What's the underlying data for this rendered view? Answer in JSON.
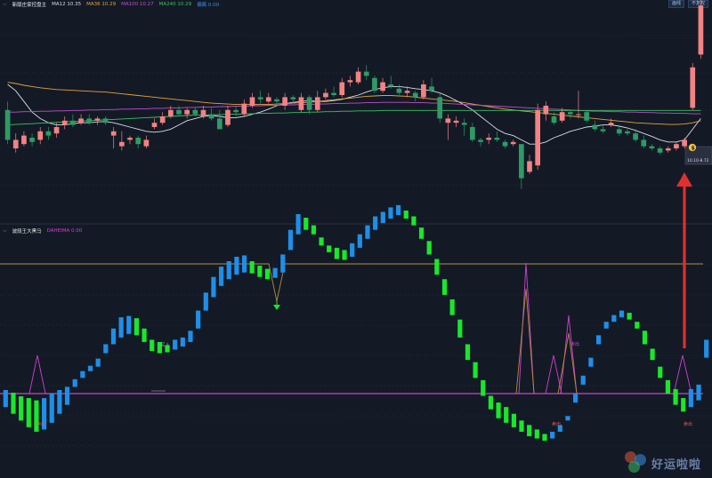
{
  "main_header": {
    "indicator_name": "新版庄家控盘主",
    "ma_items": [
      {
        "label": "MA12 10.35",
        "color": "#d8dde6"
      },
      {
        "label": "MA36 10.29",
        "color": "#e6a23c"
      },
      {
        "label": "MA100 10.27",
        "color": "#c050c8"
      },
      {
        "label": "MA240 10.29",
        "color": "#3cc060"
      },
      {
        "label": "偏离 0.00",
        "color": "#3a8ee6"
      }
    ]
  },
  "toolbar": {
    "btn1": "画线",
    "btn2": "不复权"
  },
  "price_tag": "10.10-8.72",
  "sub_header": {
    "indicator_name": "波段王大黑马",
    "item": {
      "label": "DAHEIMA 0.00",
      "color": "#d040d0"
    }
  },
  "annotations": {
    "buy": "买入",
    "sell1": "卖出",
    "sell2": "卖出",
    "sell3": "卖出",
    "sell4": "卖出"
  },
  "watermark": "好运啦啦",
  "colors": {
    "up": "#f38282",
    "down": "#2e9b65",
    "bar_blue": "#1e8fe8",
    "bar_green": "#18e82a",
    "orange_line": "#b78a3a",
    "magenta": "#d040d0",
    "arrow": "#e03030"
  },
  "chart_data": [
    {
      "type": "candlestick",
      "candles": [
        [
          10.3,
          9.6,
          10.5,
          9.5
        ],
        [
          9.4,
          9.6,
          9.75,
          9.3
        ],
        [
          9.5,
          9.7,
          9.8,
          9.45
        ],
        [
          9.65,
          9.55,
          9.75,
          9.45
        ],
        [
          9.6,
          9.8,
          9.9,
          9.5
        ],
        [
          9.8,
          9.7,
          9.9,
          9.6
        ],
        [
          9.75,
          9.9,
          10.0,
          9.65
        ],
        [
          9.95,
          10.05,
          10.15,
          9.85
        ],
        [
          10.05,
          9.95,
          10.2,
          9.9
        ],
        [
          10.0,
          10.1,
          10.2,
          9.95
        ],
        [
          10.1,
          10.0,
          10.2,
          9.95
        ],
        [
          10.05,
          10.1,
          10.15,
          9.95
        ],
        [
          10.1,
          10.0,
          10.15,
          9.95
        ],
        [
          9.7,
          9.8,
          9.9,
          9.4
        ],
        [
          9.45,
          9.55,
          9.8,
          9.35
        ],
        [
          9.6,
          9.65,
          9.7,
          9.5
        ],
        [
          9.65,
          9.5,
          9.7,
          9.4
        ],
        [
          9.45,
          9.6,
          9.7,
          9.4
        ],
        [
          9.9,
          10.0,
          10.1,
          9.85
        ],
        [
          10.0,
          10.15,
          10.25,
          9.95
        ],
        [
          10.15,
          10.3,
          10.4,
          10.1
        ],
        [
          10.3,
          10.2,
          10.4,
          10.15
        ],
        [
          10.2,
          10.3,
          10.35,
          10.1
        ],
        [
          10.3,
          10.2,
          10.35,
          10.15
        ],
        [
          10.15,
          10.3,
          10.4,
          10.1
        ],
        [
          10.2,
          10.1,
          10.35,
          10.05
        ],
        [
          10.1,
          9.85,
          10.3,
          9.85
        ],
        [
          9.95,
          10.3,
          10.4,
          9.9
        ],
        [
          10.3,
          10.25,
          10.4,
          10.15
        ],
        [
          10.2,
          10.45,
          10.55,
          10.15
        ],
        [
          10.4,
          10.6,
          10.7,
          10.35
        ],
        [
          10.6,
          10.55,
          10.75,
          10.45
        ],
        [
          10.5,
          10.6,
          10.7,
          10.45
        ],
        [
          10.55,
          10.5,
          10.6,
          10.4
        ],
        [
          10.4,
          10.6,
          10.7,
          10.3
        ],
        [
          10.6,
          10.55,
          10.65,
          10.45
        ],
        [
          10.3,
          10.6,
          10.7,
          10.25
        ],
        [
          10.6,
          10.3,
          10.65,
          10.2
        ],
        [
          10.3,
          10.6,
          10.75,
          10.25
        ],
        [
          10.6,
          10.7,
          10.8,
          10.55
        ],
        [
          10.7,
          10.65,
          10.85,
          10.6
        ],
        [
          10.65,
          10.95,
          11.05,
          10.6
        ],
        [
          10.95,
          11.0,
          11.1,
          10.85
        ],
        [
          10.95,
          11.2,
          11.3,
          10.9
        ],
        [
          11.2,
          11.1,
          11.35,
          11.0
        ],
        [
          11.05,
          10.75,
          11.1,
          10.7
        ],
        [
          10.75,
          10.95,
          11.05,
          10.7
        ],
        [
          10.9,
          10.85,
          11.1,
          10.8
        ],
        [
          10.8,
          10.7,
          10.9,
          10.65
        ],
        [
          10.7,
          10.75,
          10.85,
          10.6
        ],
        [
          10.7,
          10.6,
          10.75,
          10.5
        ],
        [
          10.6,
          10.9,
          11.0,
          10.55
        ],
        [
          10.85,
          10.75,
          11.05,
          10.7
        ],
        [
          10.6,
          10.1,
          10.7,
          10.0
        ],
        [
          10.0,
          10.1,
          10.2,
          9.6
        ],
        [
          10.0,
          10.05,
          10.15,
          9.9
        ],
        [
          10.0,
          9.95,
          10.1,
          9.7
        ],
        [
          9.9,
          9.6,
          10.0,
          9.55
        ],
        [
          9.6,
          9.55,
          9.65,
          9.45
        ],
        [
          9.6,
          9.65,
          9.75,
          9.5
        ],
        [
          9.65,
          9.6,
          9.8,
          9.55
        ],
        [
          9.55,
          9.45,
          9.6,
          9.4
        ],
        [
          9.5,
          9.55,
          9.6,
          9.45
        ],
        [
          9.5,
          8.7,
          9.5,
          8.45
        ],
        [
          8.85,
          9.1,
          9.25,
          8.8
        ],
        [
          9.0,
          10.3,
          10.45,
          8.9
        ],
        [
          10.2,
          10.4,
          10.5,
          10.05
        ],
        [
          10.15,
          10.0,
          10.25,
          9.95
        ],
        [
          10.05,
          10.25,
          10.35,
          10.0
        ],
        [
          10.25,
          10.2,
          10.3,
          10.1
        ],
        [
          10.2,
          10.2,
          10.75,
          10.1
        ],
        [
          10.25,
          10.05,
          10.3,
          10.0
        ],
        [
          9.95,
          9.85,
          10.05,
          9.8
        ],
        [
          9.85,
          9.8,
          9.95,
          9.75
        ],
        [
          9.95,
          10.0,
          10.1,
          9.9
        ],
        [
          9.85,
          9.75,
          9.95,
          9.7
        ],
        [
          9.8,
          9.75,
          9.85,
          9.7
        ],
        [
          9.75,
          9.6,
          9.85,
          9.55
        ],
        [
          9.6,
          9.45,
          9.7,
          9.4
        ],
        [
          9.45,
          9.4,
          9.5,
          9.35
        ],
        [
          9.4,
          9.3,
          9.45,
          9.25
        ],
        [
          9.35,
          9.4,
          9.45,
          9.3
        ],
        [
          9.4,
          9.5,
          9.55,
          9.35
        ],
        [
          9.45,
          9.6,
          9.65,
          9.4
        ],
        [
          10.35,
          11.3,
          11.4,
          10.3
        ],
        [
          11.6,
          12.75,
          13.35,
          11.5
        ]
      ],
      "ma_lines": [
        {
          "name": "MA12",
          "color": "#d8dde6",
          "values": [
            10.9,
            10.75,
            10.5,
            10.25,
            10.1,
            10.0,
            9.95,
            9.95,
            9.98,
            10.0,
            10.0,
            10.02,
            10.03,
            10.0,
            9.95,
            9.9,
            9.85,
            9.8,
            9.78,
            9.8,
            9.85,
            9.95,
            10.05,
            10.1,
            10.15,
            10.17,
            10.15,
            10.12,
            10.12,
            10.15,
            10.2,
            10.25,
            10.32,
            10.4,
            10.45,
            10.48,
            10.5,
            10.52,
            10.5,
            10.5,
            10.52,
            10.55,
            10.6,
            10.65,
            10.72,
            10.78,
            10.82,
            10.85,
            10.85,
            10.83,
            10.8,
            10.78,
            10.75,
            10.7,
            10.62,
            10.52,
            10.42,
            10.3,
            10.15,
            10.0,
            9.85,
            9.75,
            9.7,
            9.6,
            9.5,
            9.5,
            9.55,
            9.65,
            9.72,
            9.8,
            9.85,
            9.9,
            9.92,
            9.95,
            9.95,
            9.92,
            9.88,
            9.82,
            9.75,
            9.68,
            9.6,
            9.55,
            9.55,
            9.6,
            9.85,
            10.1
          ]
        },
        {
          "name": "MA36",
          "color": "#e6a23c",
          "values": [
            10.95,
            10.92,
            10.88,
            10.85,
            10.82,
            10.8,
            10.78,
            10.77,
            10.76,
            10.75,
            10.74,
            10.73,
            10.72,
            10.7,
            10.68,
            10.66,
            10.64,
            10.62,
            10.6,
            10.58,
            10.56,
            10.54,
            10.52,
            10.5,
            10.48,
            10.46,
            10.45,
            10.44,
            10.43,
            10.43,
            10.43,
            10.43,
            10.43,
            10.44,
            10.45,
            10.46,
            10.47,
            10.48,
            10.5,
            10.52,
            10.54,
            10.56,
            10.58,
            10.6,
            10.62,
            10.63,
            10.64,
            10.64,
            10.63,
            10.62,
            10.6,
            10.58,
            10.56,
            10.54,
            10.52,
            10.5,
            10.47,
            10.44,
            10.41,
            10.38,
            10.35,
            10.32,
            10.3,
            10.28,
            10.26,
            10.24,
            10.22,
            10.2,
            10.18,
            10.16,
            10.14,
            10.12,
            10.1,
            10.08,
            10.06,
            10.04,
            10.02,
            10.0,
            9.99,
            9.98,
            9.97,
            9.96,
            9.96,
            9.97,
            10.0,
            10.05
          ]
        },
        {
          "name": "MA100",
          "color": "#c050c8",
          "values": [
            10.25,
            10.25,
            10.26,
            10.26,
            10.27,
            10.27,
            10.28,
            10.28,
            10.29,
            10.29,
            10.3,
            10.3,
            10.31,
            10.31,
            10.32,
            10.32,
            10.33,
            10.33,
            10.34,
            10.34,
            10.35,
            10.35,
            10.36,
            10.36,
            10.37,
            10.37,
            10.38,
            10.38,
            10.39,
            10.39,
            10.4,
            10.4,
            10.41,
            10.41,
            10.42,
            10.42,
            10.43,
            10.43,
            10.44,
            10.44,
            10.45,
            10.45,
            10.46,
            10.46,
            10.47,
            10.47,
            10.48,
            10.48,
            10.48,
            10.48,
            10.47,
            10.47,
            10.46,
            10.46,
            10.45,
            10.44,
            10.43,
            10.42,
            10.41,
            10.4,
            10.39,
            10.38,
            10.37,
            10.36,
            10.35,
            10.34,
            10.33,
            10.32,
            10.31,
            10.3,
            10.29,
            10.28,
            10.27,
            10.27,
            10.26,
            10.26,
            10.25,
            10.25,
            10.24,
            10.24,
            10.23,
            10.23,
            10.22,
            10.22,
            10.21,
            10.21
          ]
        },
        {
          "name": "MA240",
          "color": "#3cc060",
          "values": [
            9.95,
            9.96,
            9.97,
            9.98,
            9.99,
            10.0,
            10.01,
            10.02,
            10.03,
            10.04,
            10.05,
            10.06,
            10.07,
            10.08,
            10.09,
            10.1,
            10.11,
            10.12,
            10.13,
            10.14,
            10.15,
            10.16,
            10.17,
            10.18,
            10.18,
            10.19,
            10.19,
            10.2,
            10.2,
            10.21,
            10.21,
            10.22,
            10.22,
            10.23,
            10.23,
            10.24,
            10.24,
            10.25,
            10.25,
            10.26,
            10.26,
            10.27,
            10.27,
            10.28,
            10.28,
            10.28,
            10.29,
            10.29,
            10.29,
            10.29,
            10.29,
            10.29,
            10.29,
            10.29,
            10.29,
            10.29,
            10.29,
            10.29,
            10.29,
            10.29,
            10.29,
            10.29,
            10.29,
            10.29,
            10.29,
            10.29,
            10.29,
            10.29,
            10.29,
            10.29,
            10.29,
            10.29,
            10.29,
            10.29,
            10.29,
            10.29,
            10.29,
            10.29,
            10.29,
            10.29,
            10.29,
            10.29,
            10.29,
            10.29,
            10.29,
            10.29
          ]
        }
      ]
    },
    {
      "type": "bar",
      "series": [
        {
          "values": [
            0.8,
            0.2,
            -0.6,
            -1.0,
            -1.5,
            -1.0,
            0.0,
            0.8,
            1.5,
            3.2,
            5.0,
            6.2,
            7.8,
            11.0,
            14.5,
            17.0,
            17.3,
            16.8,
            14.5,
            12.0,
            11.5,
            10.8,
            12.0,
            12.5,
            14.0,
            18.5,
            22.5,
            26.0,
            28.3,
            29.5,
            30.5,
            30.8,
            29.5,
            28.5,
            27.8,
            28.0,
            31.0,
            36.5,
            40.0,
            39.2,
            37.5,
            34.8,
            33.0,
            32.5,
            32.0,
            33.5,
            35.5,
            37.5,
            39.5,
            40.5,
            41.5,
            42.0,
            40.8,
            39.5,
            37.0,
            34.0,
            30.0,
            25.5,
            21.0,
            16.5,
            11.0,
            7.0,
            3.0,
            -0.5,
            -2.0,
            -3.0,
            -4.5,
            -6.0,
            -7.0,
            -8.0,
            -9.0,
            -8.5,
            -7.0,
            -5.0,
            0.0,
            4.0,
            8.0,
            13.0,
            16.0,
            17.5,
            18.5,
            18.0,
            16.0,
            14.0,
            10.0,
            6.0,
            3.0,
            1.0,
            -1.0,
            1.0,
            2.0,
            12.0
          ]
        },
        {
          "values": [
            -3.0,
            -4.5,
            -6.0,
            -7.5,
            -8.5,
            -8.0,
            -6.5,
            -4.5,
            -2.5,
            1.5,
            3.5,
            5.0,
            6.0,
            9.0,
            11.0,
            12.5,
            13.3,
            13.0,
            11.5,
            9.5,
            9.0,
            9.2,
            9.8,
            10.5,
            11.5,
            14.5,
            18.5,
            21.5,
            24.0,
            25.5,
            26.5,
            27.0,
            26.8,
            26.0,
            25.5,
            25.8,
            27.0,
            32.0,
            35.5,
            36.5,
            35.5,
            33.0,
            31.5,
            30.0,
            29.8,
            30.5,
            32.5,
            34.5,
            36.5,
            38.0,
            39.0,
            39.8,
            39.0,
            37.5,
            34.5,
            31.0,
            26.5,
            22.0,
            17.5,
            12.5,
            7.5,
            3.5,
            -0.5,
            -3.5,
            -5.5,
            -6.5,
            -7.5,
            -8.5,
            -9.5,
            -10.0,
            -10.5,
            -10.0,
            -8.5,
            -6.0,
            -2.0,
            2.0,
            6.0,
            11.0,
            14.5,
            16.0,
            17.0,
            16.5,
            14.5,
            11.0,
            7.5,
            3.5,
            0.0,
            -2.5,
            -4.0,
            -3.0,
            -1.5,
            8.0
          ]
        }
      ],
      "ylim": [
        -12,
        45
      ]
    }
  ]
}
